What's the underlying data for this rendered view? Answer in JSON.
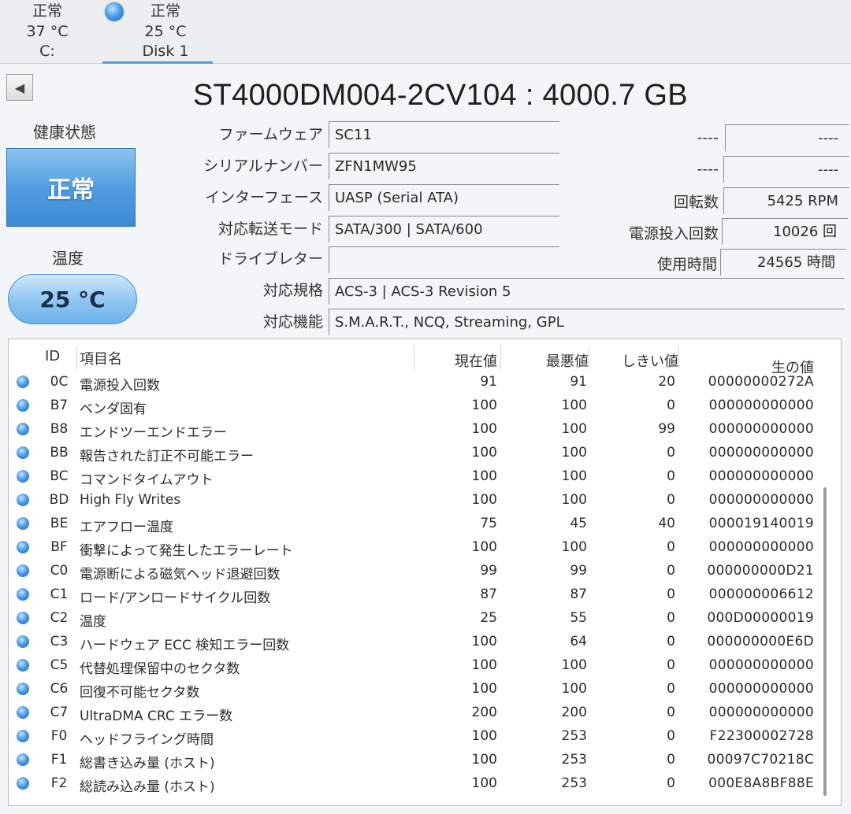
{
  "disk_bar": {
    "disks": [
      {
        "status": "正常",
        "temp": "37 °C",
        "name": "C:"
      },
      {
        "status": "正常",
        "temp": "25 °C",
        "name": "Disk 1"
      }
    ]
  },
  "title": "ST4000DM004-2CV104 : 4000.7 GB",
  "health": {
    "label": "健康状態",
    "value": "正常"
  },
  "temperature": {
    "label": "温度",
    "value": "25 °C"
  },
  "fields": {
    "firmware": {
      "label": "ファームウェア",
      "value": "SC11"
    },
    "serial": {
      "label": "シリアルナンバー",
      "value": "ZFN1MW95"
    },
    "interface": {
      "label": "インターフェース",
      "value": "UASP (Serial ATA)"
    },
    "transfer_mode": {
      "label": "対応転送モード",
      "value": "SATA/300 | SATA/600"
    },
    "drive_letter": {
      "label": "ドライブレター",
      "value": ""
    },
    "standard": {
      "label": "対応規格",
      "value": "ACS-3 | ACS-3 Revision 5"
    },
    "features": {
      "label": "対応機能",
      "value": "S.M.A.R.T., NCQ, Streaming, GPL"
    }
  },
  "right_fields": {
    "blank1": {
      "label": "----",
      "value": "----"
    },
    "blank2": {
      "label": "----",
      "value": "----"
    },
    "rotation": {
      "label": "回転数",
      "value": "5425 RPM"
    },
    "power_on_count": {
      "label": "電源投入回数",
      "value": "10026 回"
    },
    "power_on_hours": {
      "label": "使用時間",
      "value": "24565 時間"
    }
  },
  "table": {
    "headers": {
      "id": "ID",
      "name": "項目名",
      "current": "現在値",
      "worst": "最悪値",
      "threshold": "しきい値",
      "raw": "生の値"
    },
    "rows": [
      {
        "id": "0C",
        "name": "電源投入回数",
        "current": "91",
        "worst": "91",
        "threshold": "20",
        "raw": "00000000272A"
      },
      {
        "id": "B7",
        "name": "ベンダ固有",
        "current": "100",
        "worst": "100",
        "threshold": "0",
        "raw": "000000000000"
      },
      {
        "id": "B8",
        "name": "エンドツーエンドエラー",
        "current": "100",
        "worst": "100",
        "threshold": "99",
        "raw": "000000000000"
      },
      {
        "id": "BB",
        "name": "報告された訂正不可能エラー",
        "current": "100",
        "worst": "100",
        "threshold": "0",
        "raw": "000000000000"
      },
      {
        "id": "BC",
        "name": "コマンドタイムアウト",
        "current": "100",
        "worst": "100",
        "threshold": "0",
        "raw": "000000000000"
      },
      {
        "id": "BD",
        "name": "High Fly Writes",
        "current": "100",
        "worst": "100",
        "threshold": "0",
        "raw": "000000000000"
      },
      {
        "id": "BE",
        "name": "エアフロー温度",
        "current": "75",
        "worst": "45",
        "threshold": "40",
        "raw": "000019140019"
      },
      {
        "id": "BF",
        "name": "衝撃によって発生したエラーレート",
        "current": "100",
        "worst": "100",
        "threshold": "0",
        "raw": "000000000000"
      },
      {
        "id": "C0",
        "name": "電源断による磁気ヘッド退避回数",
        "current": "99",
        "worst": "99",
        "threshold": "0",
        "raw": "000000000D21"
      },
      {
        "id": "C1",
        "name": "ロード/アンロードサイクル回数",
        "current": "87",
        "worst": "87",
        "threshold": "0",
        "raw": "000000006612"
      },
      {
        "id": "C2",
        "name": "温度",
        "current": "25",
        "worst": "55",
        "threshold": "0",
        "raw": "000D00000019"
      },
      {
        "id": "C3",
        "name": "ハードウェア ECC 検知エラー回数",
        "current": "100",
        "worst": "64",
        "threshold": "0",
        "raw": "000000000E6D"
      },
      {
        "id": "C5",
        "name": "代替処理保留中のセクタ数",
        "current": "100",
        "worst": "100",
        "threshold": "0",
        "raw": "000000000000"
      },
      {
        "id": "C6",
        "name": "回復不可能セクタ数",
        "current": "100",
        "worst": "100",
        "threshold": "0",
        "raw": "000000000000"
      },
      {
        "id": "C7",
        "name": "UltraDMA CRC エラー数",
        "current": "200",
        "worst": "200",
        "threshold": "0",
        "raw": "000000000000"
      },
      {
        "id": "F0",
        "name": "ヘッドフライング時間",
        "current": "100",
        "worst": "253",
        "threshold": "0",
        "raw": "F22300002728"
      },
      {
        "id": "F1",
        "name": "総書き込み量 (ホスト)",
        "current": "100",
        "worst": "253",
        "threshold": "0",
        "raw": "00097C70218C"
      },
      {
        "id": "F2",
        "name": "総読み込み量 (ホスト)",
        "current": "100",
        "worst": "253",
        "threshold": "0",
        "raw": "000E8A8BF88E"
      }
    ]
  }
}
